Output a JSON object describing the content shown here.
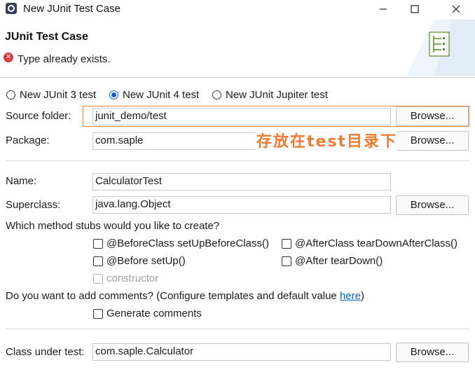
{
  "window": {
    "title": "New JUnit Test Case"
  },
  "header": {
    "title": "JUnit Test Case",
    "error_message": "Type already exists."
  },
  "junit_version": {
    "options": [
      "New JUnit 3 test",
      "New JUnit 4 test",
      "New JUnit Jupiter test"
    ],
    "selected": "New JUnit 4 test"
  },
  "source_folder": {
    "label": "Source folder:",
    "value": "junit_demo/test",
    "browse": "Browse..."
  },
  "package": {
    "label": "Package:",
    "value": "com.saple",
    "browse": "Browse..."
  },
  "name": {
    "label": "Name:",
    "value": "CalculatorTest"
  },
  "superclass": {
    "label": "Superclass:",
    "value": "java.lang.Object",
    "browse": "Browse..."
  },
  "stubs": {
    "question": "Which method stubs would you like to create?",
    "before_class": "@BeforeClass setUpBeforeClass()",
    "after_class": "@AfterClass tearDownAfterClass()",
    "before": "@Before setUp()",
    "after": "@After tearDown()",
    "constructor": "constructor"
  },
  "comments": {
    "question_prefix": "Do you want to add comments? (Configure templates and default value ",
    "link": "here",
    "question_suffix": ")",
    "generate": "Generate comments"
  },
  "class_under_test": {
    "label": "Class under test:",
    "value": "com.saple.Calculator",
    "browse": "Browse..."
  },
  "annotation": {
    "text": "存放在test目录下",
    "color": "#ee7b33"
  },
  "colors": {
    "accent": "#0a64c9",
    "error": "#e0393e",
    "highlight": "#e8873a"
  }
}
